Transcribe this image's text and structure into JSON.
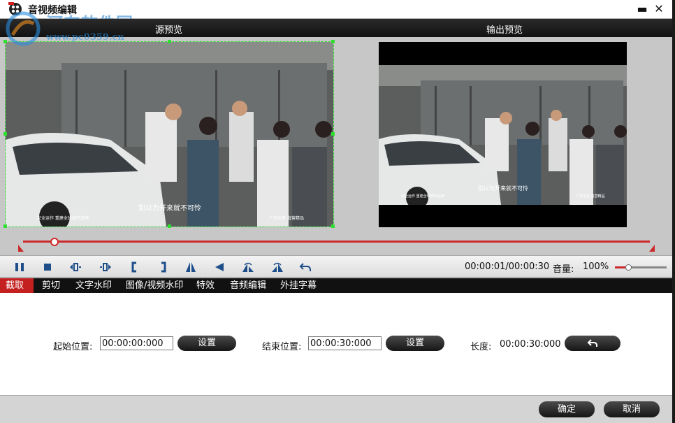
{
  "window": {
    "title": "音视频编辑",
    "watermark": "河东软件园",
    "watermark_url": "www.pc0359.cn",
    "close_glyph": "✕",
    "minimize_glyph": "▬"
  },
  "preview": {
    "source_label": "源预览",
    "output_label": "输出预览",
    "source_subtitle": "别以为开来就不可怜",
    "output_subtitle": "别以为开来就不可怜",
    "caption_left": "安全运作 重建全球城市品牌",
    "caption_right": "广告创意 直营精品",
    "crop_color": "#2ee02e"
  },
  "timeline": {
    "position_fraction": 0.05,
    "accent": "#cc2a2a"
  },
  "controls": {
    "buttons": [
      "pause-icon",
      "stop-icon",
      "prev-frame-icon",
      "next-frame-icon",
      "mark-in-icon",
      "mark-out-icon",
      "flip-vertical-icon",
      "rotate-left-icon",
      "mirror-icon",
      "mirror-alt-icon",
      "undo-icon"
    ],
    "time": "00:00:01/00:00:30",
    "volume_label": "音量:",
    "volume_value": "100%",
    "volume_fraction": 0.25
  },
  "tabs": [
    {
      "label": "截取",
      "active": true
    },
    {
      "label": "剪切",
      "active": false
    },
    {
      "label": "文字水印",
      "active": false
    },
    {
      "label": "图像/视频水印",
      "active": false
    },
    {
      "label": "特效",
      "active": false
    },
    {
      "label": "音频编辑",
      "active": false
    },
    {
      "label": "外挂字幕",
      "active": false
    }
  ],
  "trim": {
    "start_label": "起始位置:",
    "start_value": "00:00:00:000",
    "start_set": "设置",
    "end_label": "结束位置:",
    "end_value": "00:00:30:000",
    "end_set": "设置",
    "length_label": "长度:",
    "length_value": "00:00:30:000",
    "reset_icon": "undo-icon"
  },
  "footer": {
    "ok": "确定",
    "cancel": "取消"
  }
}
